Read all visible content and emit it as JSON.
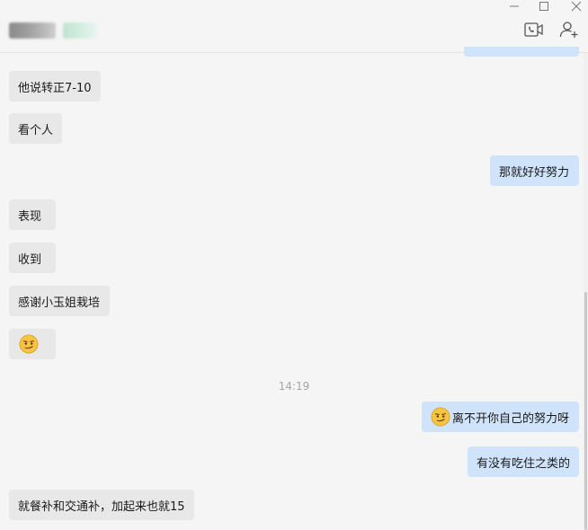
{
  "window": {
    "minimize_glyph": "—",
    "maximize_glyph": "☐",
    "close_glyph": "✕"
  },
  "header": {
    "icons": [
      "video-call-icon",
      "add-contact-icon"
    ]
  },
  "timestamp": "14:19",
  "messages": [
    {
      "side": "in",
      "text": "他说转正7-10"
    },
    {
      "side": "in",
      "text": "看个人"
    },
    {
      "side": "out",
      "text": "那就好好努力"
    },
    {
      "side": "in",
      "text": "表现"
    },
    {
      "side": "in",
      "text": "收到"
    },
    {
      "side": "in",
      "text": "感谢小玉姐栽培"
    },
    {
      "side": "in",
      "text": "",
      "emoji": "smirk-emoji"
    },
    {
      "side": "out",
      "text": "离不开你自己的努力呀",
      "emoji": "smirk-emoji"
    },
    {
      "side": "out",
      "text": "有没有吃住之类的"
    },
    {
      "side": "in",
      "text": "就餐补和交通补，加起来也就15"
    }
  ],
  "colors": {
    "incoming_bubble": "#e8e8e8",
    "outgoing_bubble": "#cfe3fb",
    "background": "#f5f5f5"
  }
}
